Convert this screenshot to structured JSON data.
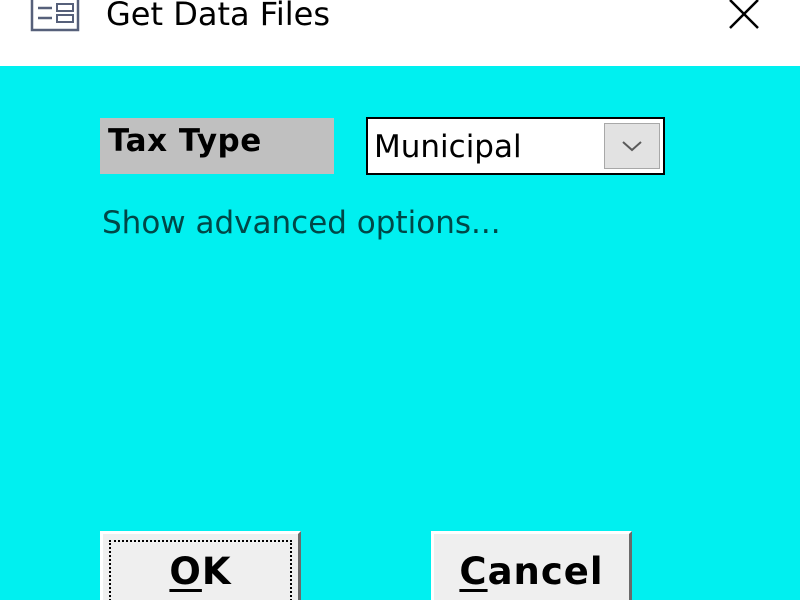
{
  "window": {
    "title": "Get Data Files"
  },
  "form": {
    "tax_type_label": "Tax Type",
    "tax_type_value": "Municipal",
    "advanced_link": "Show advanced options..."
  },
  "buttons": {
    "ok_mnemonic": "O",
    "ok_rest": "K",
    "cancel_mnemonic": "C",
    "cancel_rest": "ancel"
  },
  "icons": {
    "window_icon": "form-icon",
    "close": "close-icon",
    "dropdown": "chevron-down-icon"
  },
  "colors": {
    "background": "#00f0f0",
    "titlebar": "#ffffff",
    "label_background": "#c0c0c0",
    "link_text": "#004747"
  }
}
